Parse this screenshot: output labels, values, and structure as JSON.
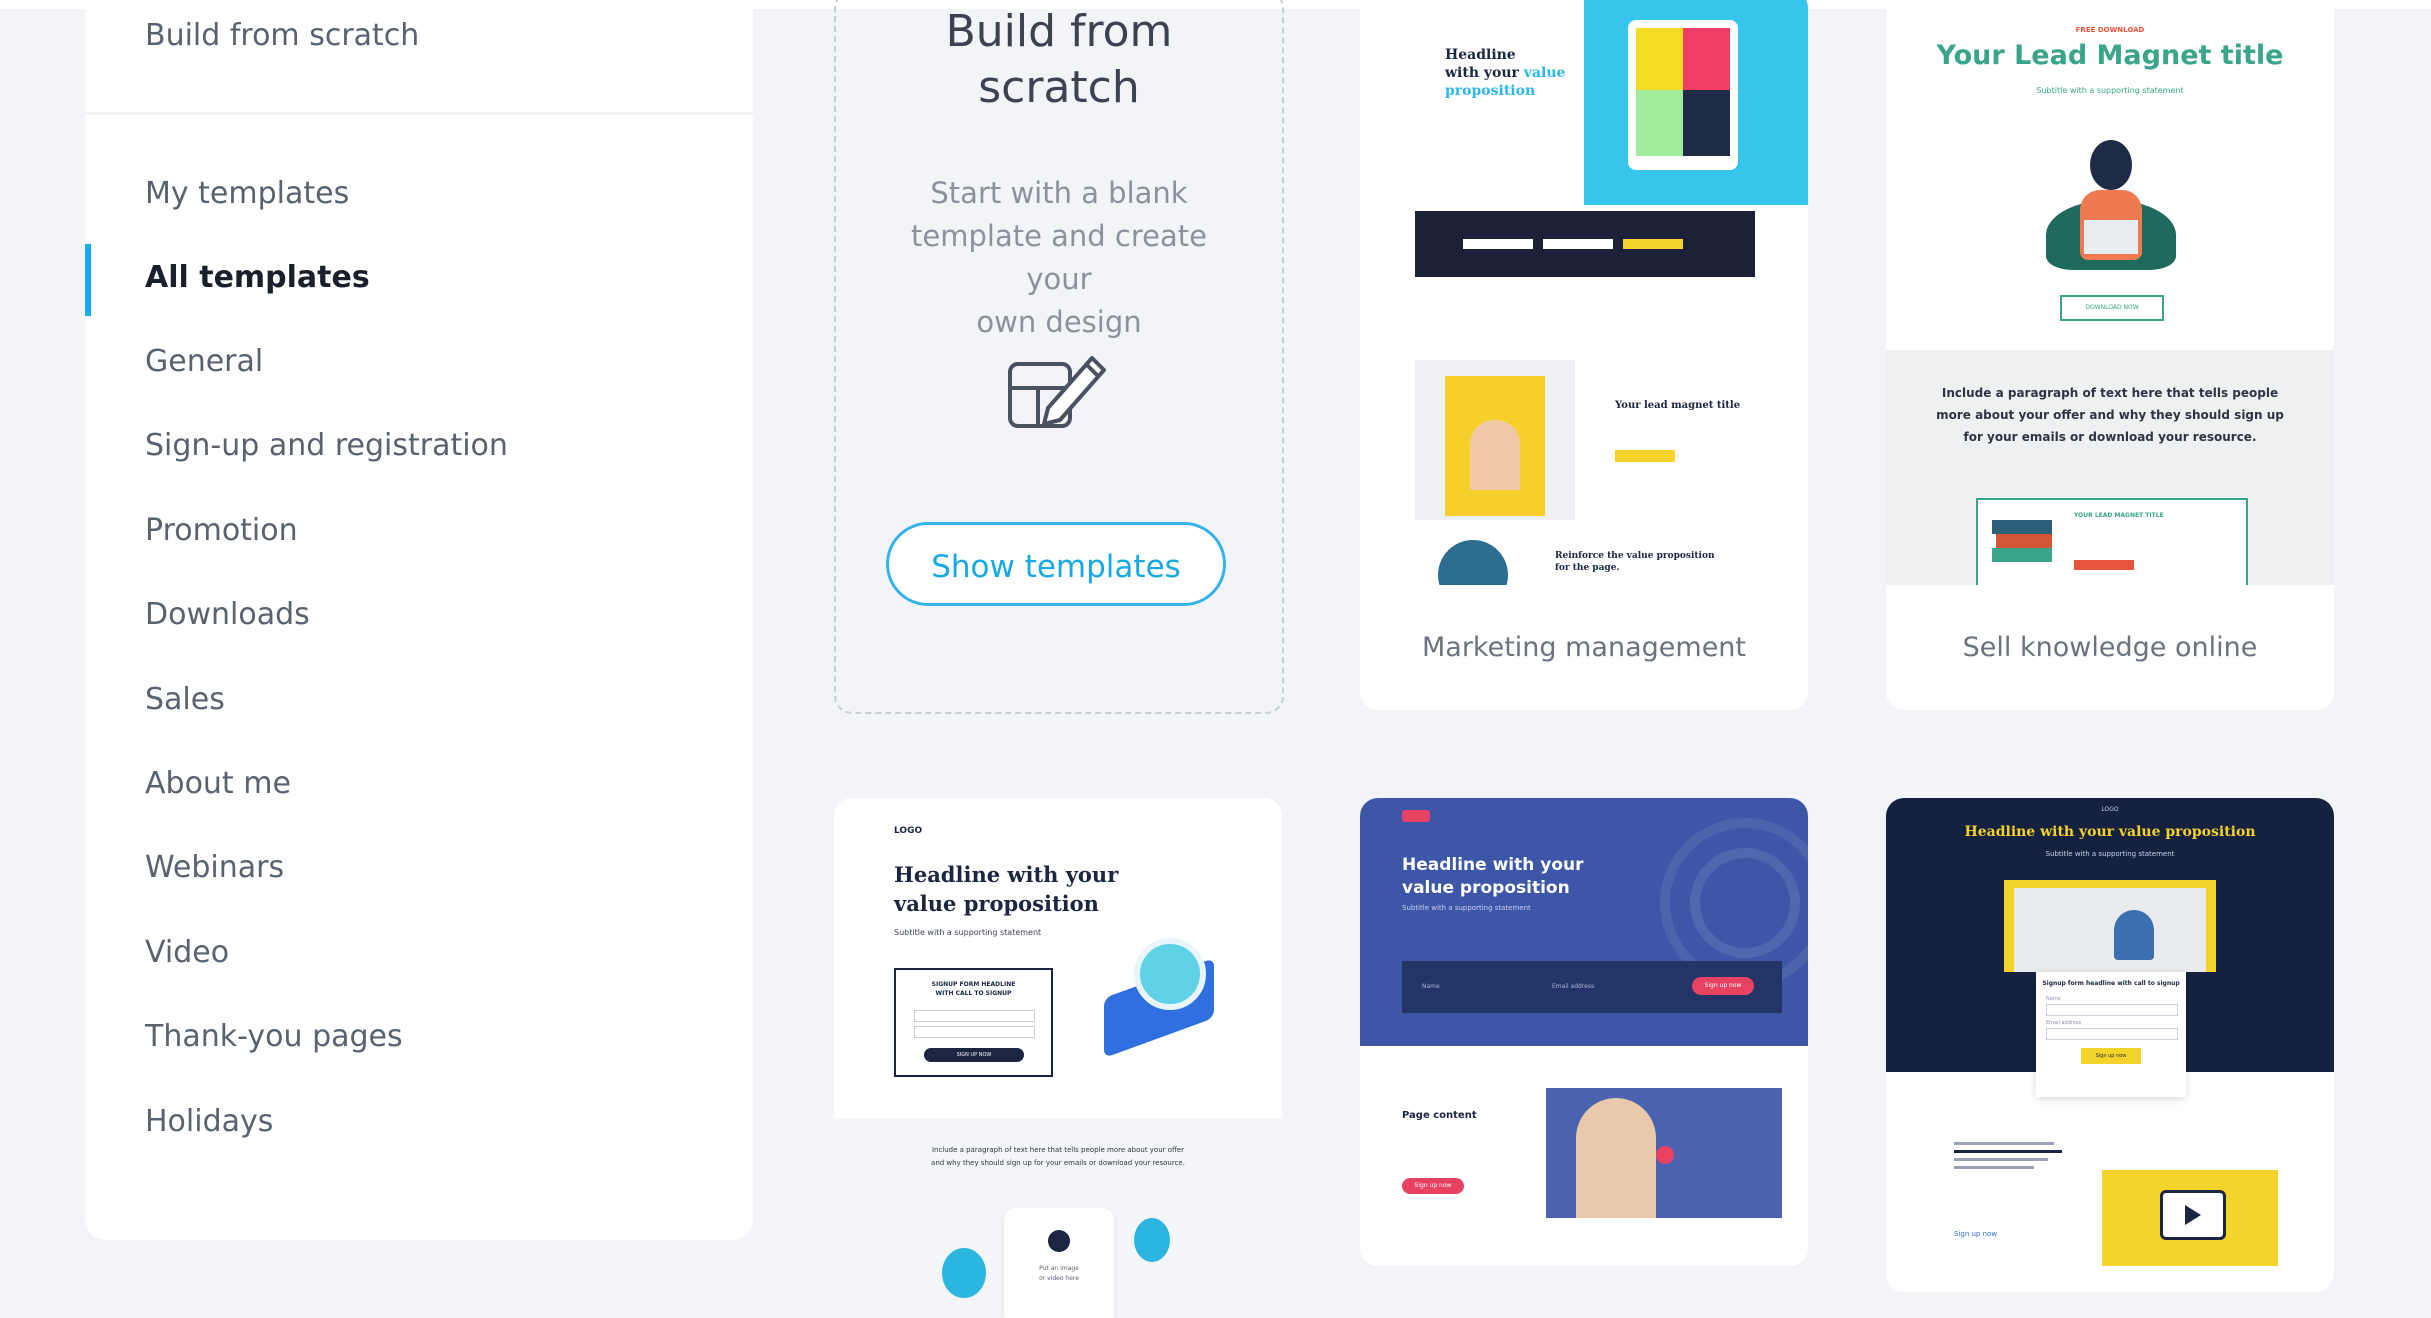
{
  "sidebar": {
    "build_from_scratch": "Build from scratch",
    "items": [
      {
        "label": "My templates"
      },
      {
        "label": "All templates",
        "active": true
      },
      {
        "label": "General"
      },
      {
        "label": "Sign-up and registration"
      },
      {
        "label": "Promotion"
      },
      {
        "label": "Downloads"
      },
      {
        "label": "Sales"
      },
      {
        "label": "About me"
      },
      {
        "label": "Webinars"
      },
      {
        "label": "Video"
      },
      {
        "label": "Thank-you pages"
      },
      {
        "label": "Holidays"
      }
    ]
  },
  "blank_card": {
    "title_line1": "Build from",
    "title_line2": "scratch",
    "desc_line1": "Start with a blank",
    "desc_line2": "template and create your",
    "desc_line3": "own design",
    "icon": "edit-template-icon",
    "button": "Show templates"
  },
  "templates": [
    {
      "caption": "Marketing management",
      "headline_1": "Headline",
      "headline_2": "with your",
      "headline_3": "value",
      "headline_4": "proposition",
      "magnet_title": "Your lead magnet title",
      "reinforce_1": "Reinforce the value proposition",
      "reinforce_2": "for the page."
    },
    {
      "caption": "Sell knowledge online",
      "kicker": "FREE DOWNLOAD",
      "title": "Your Lead Magnet title",
      "subtitle": "Subtitle with a supporting statement",
      "button": "DOWNLOAD NOW",
      "para_1": "Include a paragraph of text here that tells people",
      "para_2": "more about your offer and why they should sign up",
      "para_3": "for your emails or download your resource.",
      "box_title": "YOUR LEAD MAGNET TITLE"
    },
    {
      "logo": "LOGO",
      "headline_1": "Headline with your",
      "headline_2": "value proposition",
      "subtitle": "Subtitle with a supporting statement",
      "form_title_1": "SIGNUP FORM HEADLINE",
      "form_title_2": "WITH CALL TO SIGNUP",
      "form_button": "SIGN UP NOW",
      "para_1": "Include a paragraph of text here that tells people more about your offer",
      "para_2": "and why they should sign up for your emails or download your resource.",
      "media_1": "Put an image",
      "media_2": "or video here"
    },
    {
      "headline_1": "Headline with your",
      "headline_2": "value proposition",
      "subtitle": "Subtitle with a supporting statement",
      "field_name": "Name",
      "field_email": "Email address",
      "cta": "Sign up now",
      "content_title": "Page content",
      "content_cta": "Sign up now"
    },
    {
      "logo": "LOGO",
      "headline": "Headline with your value proposition",
      "subtitle": "Subtitle with a supporting statement",
      "form_title": "Signup form headline with call to signup",
      "field_name": "Name",
      "field_email": "Email address",
      "button": "Sign up now",
      "link": "Sign up now"
    }
  ]
}
